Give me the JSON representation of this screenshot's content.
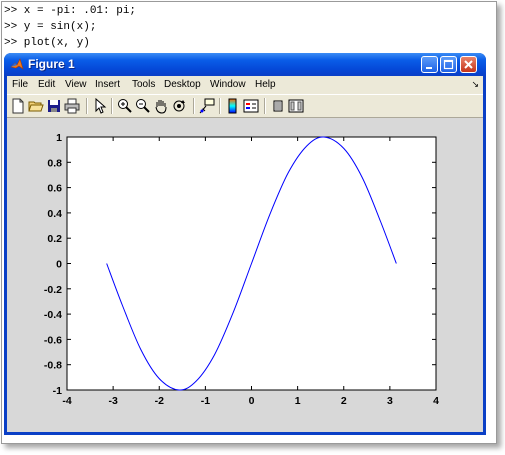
{
  "command_window": {
    "lines": [
      ">> x = -pi: .01: pi;",
      ">> y = sin(x);",
      ">> plot(x, y)"
    ]
  },
  "figure_window": {
    "title": "Figure 1",
    "title_icon": "matlab-logo-icon",
    "controls": [
      "minimize-icon",
      "maximize-icon",
      "close-icon"
    ]
  },
  "menu": {
    "items": [
      "File",
      "Edit",
      "View",
      "Insert",
      "Tools",
      "Desktop",
      "Window",
      "Help"
    ],
    "corner_glyph": "↘"
  },
  "toolbar": {
    "icons": [
      "new-figure-icon",
      "open-file-icon",
      "save-icon",
      "print-icon",
      "edit-plot-arrow-icon",
      "zoom-in-icon",
      "zoom-out-icon",
      "pan-hand-icon",
      "rotate-3d-icon",
      "data-cursor-icon",
      "insert-colorbar-icon",
      "insert-legend-icon",
      "hide-plot-tools-icon",
      "show-plot-tools-icon"
    ]
  },
  "chart_data": {
    "type": "line",
    "title": "",
    "xlabel": "",
    "ylabel": "",
    "xlim": [
      -4,
      4
    ],
    "ylim": [
      -1,
      1
    ],
    "xticks": [
      -4,
      -3,
      -2,
      -1,
      0,
      1,
      2,
      3,
      4
    ],
    "yticks": [
      -1,
      -0.8,
      -0.6,
      -0.4,
      -0.2,
      0,
      0.2,
      0.4,
      0.6,
      0.8,
      1
    ],
    "xtick_labels": [
      "-4",
      "-3",
      "-2",
      "-1",
      "0",
      "1",
      "2",
      "3",
      "4"
    ],
    "ytick_labels": [
      "-1",
      "-0.8",
      "-0.6",
      "-0.4",
      "-0.2",
      "0",
      "0.2",
      "0.4",
      "0.6",
      "0.8",
      "1"
    ],
    "grid": false,
    "series": [
      {
        "color": "#0000ff",
        "x": [
          -3.14,
          -2.8,
          -2.4,
          -2.0,
          -1.57,
          -1.2,
          -0.8,
          -0.4,
          0.0,
          0.4,
          0.8,
          1.2,
          1.57,
          2.0,
          2.4,
          2.8,
          3.14
        ],
        "y": [
          0.0,
          -0.33,
          -0.68,
          -0.91,
          -1.0,
          -0.93,
          -0.72,
          -0.39,
          0.0,
          0.39,
          0.72,
          0.93,
          1.0,
          0.91,
          0.68,
          0.33,
          0.0
        ]
      }
    ]
  }
}
